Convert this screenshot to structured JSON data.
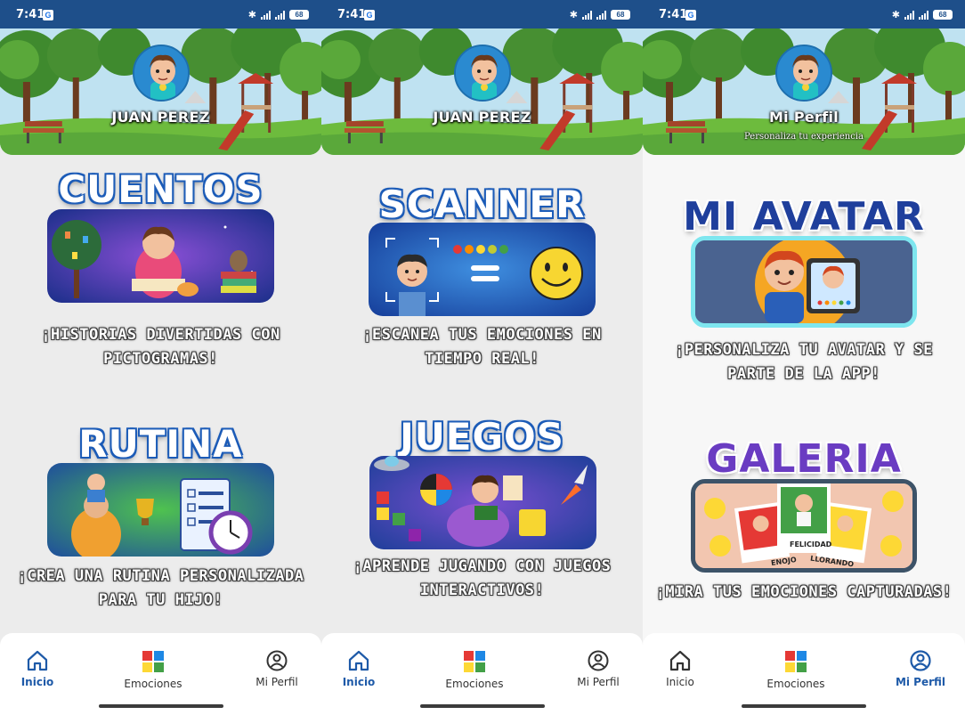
{
  "status_bar": {
    "time": "7:41",
    "google_badge": "G",
    "battery": "68"
  },
  "screens": [
    {
      "header": {
        "title": "JUAN PEREZ",
        "subtitle": ""
      },
      "cards": [
        {
          "title": "CUENTOS",
          "description_line1": "¡HISTORIAS DIVERTIDAS CON",
          "description_line2": "PICTOGRAMAS!"
        },
        {
          "title": "RUTINA",
          "description_line1": "¡CREA UNA RUTINA PERSONALIZADA",
          "description_line2": "PARA TU HIJO!"
        }
      ],
      "nav": {
        "home": "Inicio",
        "emotions": "Emociones",
        "profile": "Mi Perfil",
        "active": "home"
      }
    },
    {
      "header": {
        "title": "JUAN PEREZ",
        "subtitle": ""
      },
      "cards": [
        {
          "title": "SCANNER",
          "description_line1": "¡ESCANEA TUS EMOCIONES EN",
          "description_line2": "TIEMPO REAL!"
        },
        {
          "title": "JUEGOS",
          "description_line1": "¡APRENDE JUGANDO CON JUEGOS",
          "description_line2": "INTERACTIVOS!"
        }
      ],
      "nav": {
        "home": "Inicio",
        "emotions": "Emociones",
        "profile": "Mi Perfil",
        "active": "home"
      }
    },
    {
      "header": {
        "title": "Mi Perfil",
        "subtitle": "Personaliza tu experiencia"
      },
      "cards": [
        {
          "title": "MI AVATAR",
          "description_line1": "¡PERSONALIZA TU AVATAR Y SE",
          "description_line2": "PARTE DE LA APP!"
        },
        {
          "title": "GALERIA",
          "description_line1": "¡MIRA TUS EMOCIONES CAPTURADAS!",
          "description_line2": "",
          "photo_labels": [
            "FELICIDAD",
            "ENOJO",
            "LLORANDO"
          ]
        }
      ],
      "nav": {
        "home": "Inicio",
        "emotions": "Emociones",
        "profile": "Mi Perfil",
        "active": "profile"
      }
    }
  ],
  "colors": {
    "status_bar": "#1e4f8a",
    "nav_active": "#1e5aa8",
    "title_white_outline": "#1e5db8",
    "title_navy": "#1f3f9c",
    "title_purple": "#6a3cc2"
  },
  "icons": [
    "bluetooth-icon",
    "signal-icon",
    "battery-icon",
    "home-icon",
    "puzzle-icon",
    "profile-icon"
  ]
}
